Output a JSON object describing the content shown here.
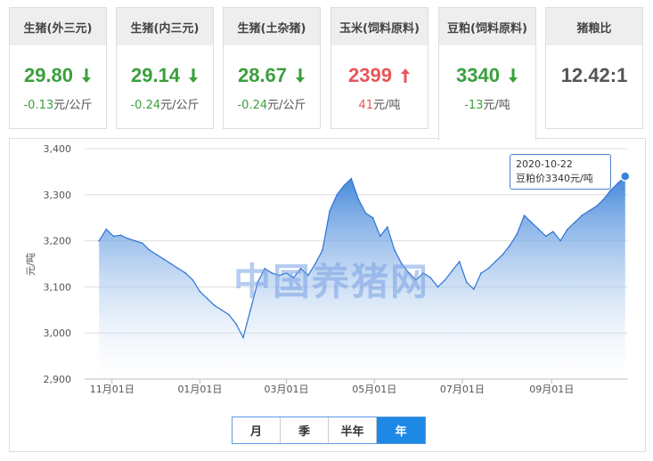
{
  "cards": [
    {
      "title": "生猪(外三元)",
      "price": "29.80",
      "direction": "down",
      "change": "-0.13",
      "unit": "元/公斤"
    },
    {
      "title": "生猪(内三元)",
      "price": "29.14",
      "direction": "down",
      "change": "-0.24",
      "unit": "元/公斤"
    },
    {
      "title": "生猪(土杂猪)",
      "price": "28.67",
      "direction": "down",
      "change": "-0.24",
      "unit": "元/公斤"
    },
    {
      "title": "玉米(饲料原料)",
      "price": "2399",
      "direction": "up",
      "change": "41",
      "unit": "元/吨"
    },
    {
      "title": "豆粕(饲料原料)",
      "price": "3340",
      "direction": "down",
      "change": "-13",
      "unit": "元/吨"
    },
    {
      "title": "猪粮比",
      "price": "12.42:1",
      "direction": "neutral",
      "change": "",
      "unit": ""
    }
  ],
  "colors": {
    "down": "#3aa03c",
    "up": "#e8555a",
    "line": "#2f73d6",
    "fill_top": "#3b82d9",
    "fill_bottom": "#ffffff",
    "active_range": "#1e88e5"
  },
  "watermark": "中国养猪网",
  "tooltip": {
    "date": "2020-10-22",
    "label": "豆粕价3340元/吨"
  },
  "ranges": [
    {
      "label": "月",
      "active": false
    },
    {
      "label": "季",
      "active": false
    },
    {
      "label": "半年",
      "active": false
    },
    {
      "label": "年",
      "active": true
    }
  ],
  "chart_data": {
    "type": "area",
    "ylabel": "元/吨",
    "ylim": [
      2900,
      3400
    ],
    "yticks": [
      "2,900",
      "3,000",
      "3,100",
      "3,200",
      "3,300",
      "3,400"
    ],
    "ytick_values": [
      2900,
      3000,
      3100,
      3200,
      3300,
      3400
    ],
    "xticks": [
      "11月01日",
      "01月01日",
      "03月01日",
      "05月01日",
      "07月01日",
      "09月01日"
    ],
    "grid": true,
    "x": [
      "2019-10-23",
      "2019-10-28",
      "2019-11-02",
      "2019-11-07",
      "2019-11-12",
      "2019-11-17",
      "2019-11-22",
      "2019-11-27",
      "2019-12-02",
      "2019-12-07",
      "2019-12-12",
      "2019-12-17",
      "2019-12-22",
      "2019-12-27",
      "2020-01-01",
      "2020-01-06",
      "2020-01-11",
      "2020-01-16",
      "2020-01-21",
      "2020-01-26",
      "2020-01-31",
      "2020-02-05",
      "2020-02-10",
      "2020-02-15",
      "2020-02-20",
      "2020-02-25",
      "2020-03-01",
      "2020-03-06",
      "2020-03-11",
      "2020-03-16",
      "2020-03-21",
      "2020-03-26",
      "2020-03-31",
      "2020-04-05",
      "2020-04-10",
      "2020-04-15",
      "2020-04-20",
      "2020-04-25",
      "2020-04-30",
      "2020-05-05",
      "2020-05-10",
      "2020-05-15",
      "2020-05-20",
      "2020-05-25",
      "2020-05-30",
      "2020-06-04",
      "2020-06-09",
      "2020-06-14",
      "2020-06-19",
      "2020-06-24",
      "2020-06-29",
      "2020-07-04",
      "2020-07-09",
      "2020-07-14",
      "2020-07-19",
      "2020-07-24",
      "2020-07-29",
      "2020-08-03",
      "2020-08-08",
      "2020-08-13",
      "2020-08-18",
      "2020-08-23",
      "2020-08-28",
      "2020-09-02",
      "2020-09-07",
      "2020-09-12",
      "2020-09-17",
      "2020-09-22",
      "2020-09-27",
      "2020-10-02",
      "2020-10-07",
      "2020-10-12",
      "2020-10-17",
      "2020-10-22"
    ],
    "values": [
      3200,
      3225,
      3210,
      3212,
      3205,
      3200,
      3195,
      3180,
      3170,
      3160,
      3150,
      3140,
      3130,
      3115,
      3090,
      3075,
      3060,
      3050,
      3040,
      3020,
      2990,
      3050,
      3110,
      3140,
      3130,
      3125,
      3130,
      3120,
      3140,
      3125,
      3150,
      3180,
      3265,
      3300,
      3320,
      3335,
      3290,
      3260,
      3250,
      3210,
      3230,
      3180,
      3150,
      3130,
      3115,
      3130,
      3120,
      3100,
      3115,
      3135,
      3155,
      3110,
      3095,
      3130,
      3140,
      3155,
      3170,
      3190,
      3215,
      3255,
      3240,
      3225,
      3210,
      3220,
      3200,
      3225,
      3240,
      3255,
      3265,
      3275,
      3290,
      3310,
      3325,
      3340
    ],
    "series": [
      {
        "name": "豆粕价",
        "unit": "元/吨"
      }
    ]
  }
}
